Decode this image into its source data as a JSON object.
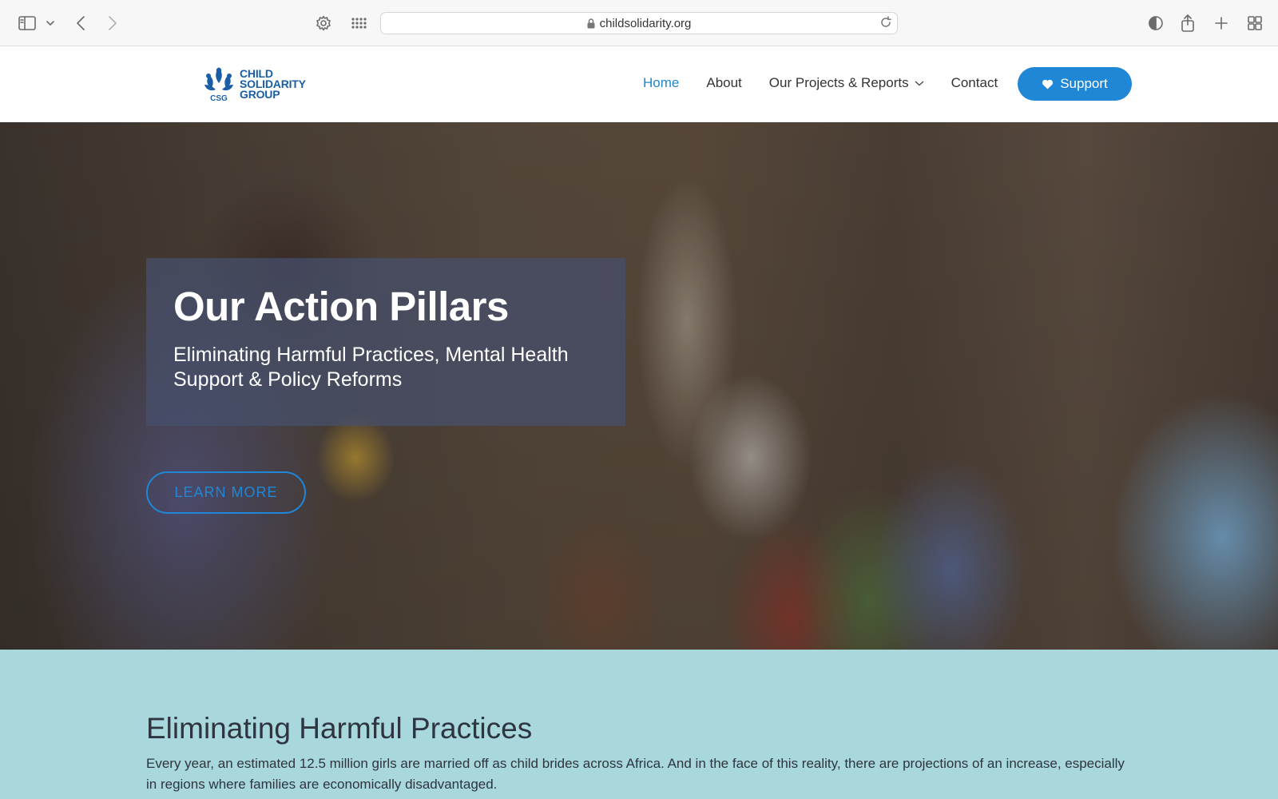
{
  "browser": {
    "url": "childsolidarity.org"
  },
  "logo": {
    "line1": "CHILD",
    "line2": "SOLIDARITY",
    "line3": "GROUP",
    "mark": "CSG",
    "brand_color": "#1a5fa5"
  },
  "nav": {
    "items": [
      {
        "label": "Home",
        "active": true
      },
      {
        "label": "About"
      },
      {
        "label": "Our Projects & Reports"
      },
      {
        "label": "Contact"
      }
    ],
    "support_label": "Support",
    "accent_color": "#1f87d6"
  },
  "hero": {
    "title": "Our Action Pillars",
    "subtitle": "Eliminating Harmful Practices, Mental Health Support & Policy Reforms",
    "button_label": "LEARN MORE"
  },
  "section": {
    "title": "Eliminating Harmful Practices",
    "text": "Every year, an estimated 12.5 million girls are married off as child brides across Africa. And in the face of this reality, there are projections of an increase, especially in regions where families are economically disadvantaged.",
    "background_color": "#a8d8db"
  }
}
